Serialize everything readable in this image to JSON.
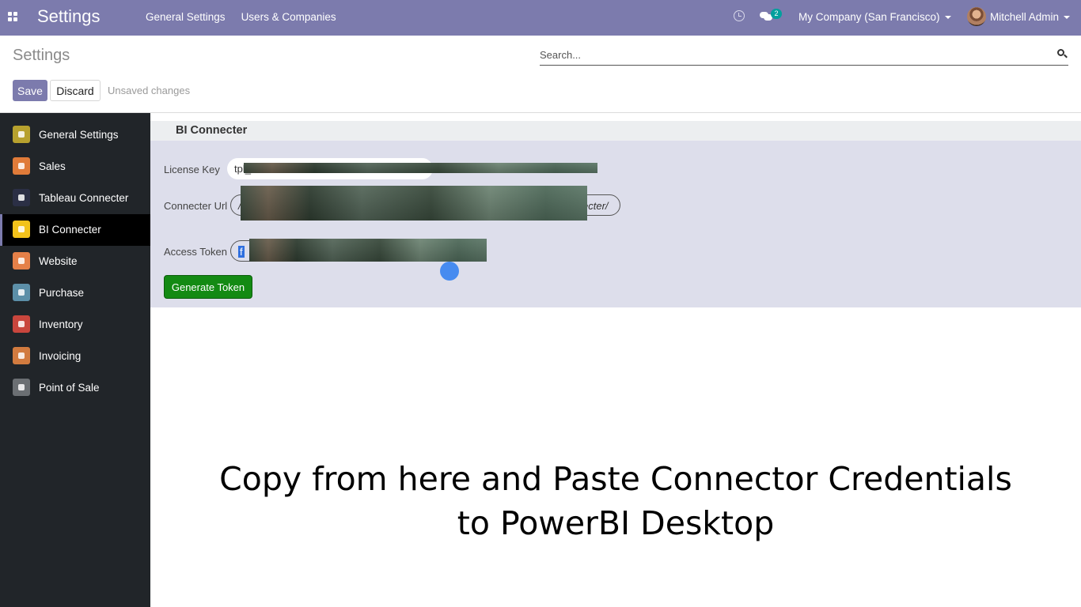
{
  "navbar": {
    "brand": "Settings",
    "menu": [
      "General Settings",
      "Users & Companies"
    ],
    "chat_badge": "2",
    "company": "My Company (San Francisco)",
    "user": "Mitchell Admin",
    "color": "#7c7bad"
  },
  "control_panel": {
    "title": "Settings",
    "search_placeholder": "Search...",
    "save_label": "Save",
    "discard_label": "Discard",
    "status": "Unsaved changes"
  },
  "sidebar": {
    "items": [
      {
        "label": "General Settings",
        "icon": "gear-icon",
        "color": "#b7a12e"
      },
      {
        "label": "Sales",
        "icon": "chart-line-icon",
        "color": "#e07b39"
      },
      {
        "label": "Tableau Connecter",
        "icon": "tableau-icon",
        "color": "#2b2f45"
      },
      {
        "label": "BI Connecter",
        "icon": "bi-connecter-icon",
        "color": "#f2c21b",
        "active": true
      },
      {
        "label": "Website",
        "icon": "globe-icon",
        "color": "#e58048"
      },
      {
        "label": "Purchase",
        "icon": "credit-card-icon",
        "color": "#5c8fa8"
      },
      {
        "label": "Inventory",
        "icon": "boxes-icon",
        "color": "#c9463d"
      },
      {
        "label": "Invoicing",
        "icon": "invoice-icon",
        "color": "#d27b3f"
      },
      {
        "label": "Point of Sale",
        "icon": "store-icon",
        "color": "#6b6f73"
      }
    ]
  },
  "section": {
    "title": "BI Connecter",
    "license_key": {
      "label": "License Key",
      "value": "tpl_"
    },
    "connecter_url": {
      "label": "Connecter Url",
      "value_start": "/",
      "value_end": "ecter/"
    },
    "access_token": {
      "label": "Access Token",
      "value": "f"
    },
    "generate_label": "Generate Token"
  },
  "caption": {
    "line1": "Copy from here and Paste Connector Credentials",
    "line2": "to PowerBI Desktop"
  }
}
